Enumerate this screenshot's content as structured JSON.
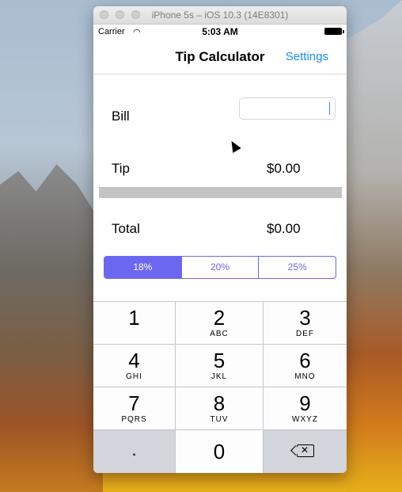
{
  "window": {
    "title": "iPhone 5s – iOS 10.3 (14E8301)"
  },
  "status_bar": {
    "carrier": "Carrier",
    "time": "5:03 AM"
  },
  "nav": {
    "title": "Tip Calculator",
    "settings_label": "Settings"
  },
  "form": {
    "bill_label": "Bill",
    "bill_value": "",
    "tip_label": "Tip",
    "tip_value": "$0.00",
    "total_label": "Total",
    "total_value": "$0.00"
  },
  "tip_options": [
    "18%",
    "20%",
    "25%"
  ],
  "tip_selected": "18%",
  "keypad": {
    "keys": [
      {
        "digit": "1",
        "letters": ""
      },
      {
        "digit": "2",
        "letters": "ABC"
      },
      {
        "digit": "3",
        "letters": "DEF"
      },
      {
        "digit": "4",
        "letters": "GHI"
      },
      {
        "digit": "5",
        "letters": "JKL"
      },
      {
        "digit": "6",
        "letters": "MNO"
      },
      {
        "digit": "7",
        "letters": "PQRS"
      },
      {
        "digit": "8",
        "letters": "TUV"
      },
      {
        "digit": "9",
        "letters": "WXYZ"
      }
    ],
    "decimal": ".",
    "zero": "0"
  },
  "colors": {
    "accent": "#6b67f0",
    "link": "#1a8cff"
  }
}
